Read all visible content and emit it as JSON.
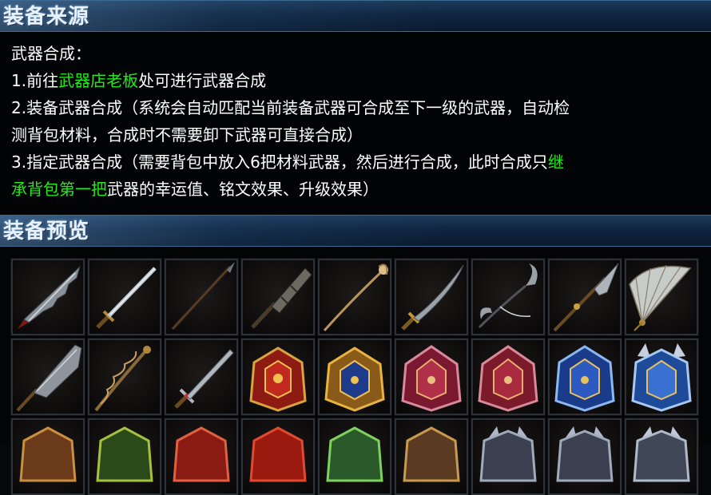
{
  "sections": {
    "source_title": "装备来源",
    "preview_title": "装备预览"
  },
  "description": {
    "heading": "武器合成：",
    "line1": {
      "prefix": "1.前往",
      "link": "武器店老板",
      "suffix": "处可进行武器合成"
    },
    "line2a": "2.装备武器合成（系统会自动匹配当前装备武器可合成至下一级的武器，自动检",
    "line2b": "测背包材料，合成时不需要卸下武器可直接合成）",
    "line3a": {
      "prefix": "3.指定武器合成（需要背包中放入6把材料武器，然后进行合成，此时合成只",
      "highlight": "继"
    },
    "line3b": {
      "highlight": "承背包第一把",
      "suffix": "武器的幸运值、铭文效果、升级效果）"
    }
  },
  "colors": {
    "highlight": "#27e81d",
    "header_bg": "#0f2540",
    "slot_border": "#2d3036"
  },
  "items": [
    {
      "icon": "broad-saber-icon"
    },
    {
      "icon": "long-sword-icon"
    },
    {
      "icon": "dark-spear-icon"
    },
    {
      "icon": "bamboo-club-icon"
    },
    {
      "icon": "golden-staff-icon"
    },
    {
      "icon": "curved-blade-icon"
    },
    {
      "icon": "double-sickle-icon"
    },
    {
      "icon": "serpent-spear-icon"
    },
    {
      "icon": "war-fan-icon"
    },
    {
      "icon": "guan-dao-icon"
    },
    {
      "icon": "dragon-staff-icon"
    },
    {
      "icon": "jeweled-sword-icon"
    },
    {
      "icon": "red-gold-armor-icon"
    },
    {
      "icon": "gold-blue-armor-icon"
    },
    {
      "icon": "crimson-armor-icon"
    },
    {
      "icon": "crimson-armor-alt-icon"
    },
    {
      "icon": "blue-armor-icon"
    },
    {
      "icon": "blue-horned-armor-icon"
    },
    {
      "icon": "armor-row3-1-icon"
    },
    {
      "icon": "armor-row3-2-icon"
    },
    {
      "icon": "armor-row3-3-icon"
    },
    {
      "icon": "armor-row3-4-icon"
    },
    {
      "icon": "armor-row3-5-icon"
    },
    {
      "icon": "armor-row3-6-icon"
    },
    {
      "icon": "armor-row3-7-icon"
    },
    {
      "icon": "armor-row3-8-icon"
    },
    {
      "icon": "armor-row3-9-icon"
    }
  ]
}
